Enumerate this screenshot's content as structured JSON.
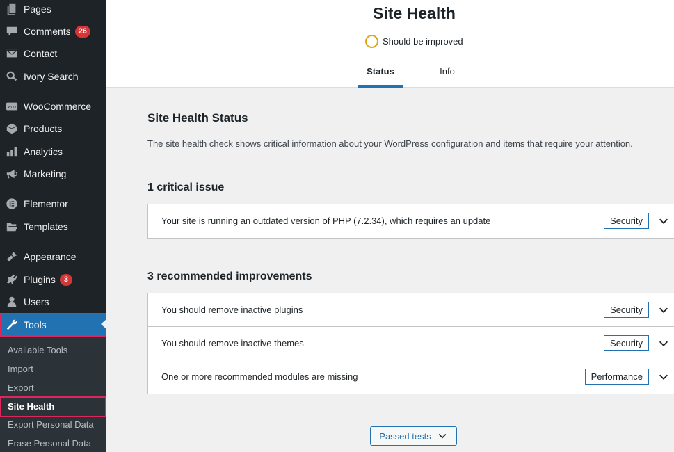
{
  "sidebar": {
    "items": [
      {
        "label": "Pages",
        "icon": "pages-icon"
      },
      {
        "label": "Comments",
        "icon": "comments-icon",
        "badge": "26"
      },
      {
        "label": "Contact",
        "icon": "envelope-icon"
      },
      {
        "label": "Ivory Search",
        "icon": "search-icon"
      },
      {
        "label": "WooCommerce",
        "icon": "woocommerce-icon"
      },
      {
        "label": "Products",
        "icon": "box-icon"
      },
      {
        "label": "Analytics",
        "icon": "bar-chart-icon"
      },
      {
        "label": "Marketing",
        "icon": "megaphone-icon"
      },
      {
        "label": "Elementor",
        "icon": "elementor-icon"
      },
      {
        "label": "Templates",
        "icon": "folder-icon"
      },
      {
        "label": "Appearance",
        "icon": "paintbrush-icon"
      },
      {
        "label": "Plugins",
        "icon": "plugin-icon",
        "badge": "3"
      },
      {
        "label": "Users",
        "icon": "user-icon"
      },
      {
        "label": "Tools",
        "icon": "wrench-icon",
        "active": true
      }
    ],
    "submenu": [
      {
        "label": "Available Tools"
      },
      {
        "label": "Import"
      },
      {
        "label": "Export"
      },
      {
        "label": "Site Health",
        "current": true
      },
      {
        "label": "Export Personal Data"
      },
      {
        "label": "Erase Personal Data"
      }
    ]
  },
  "header": {
    "title": "Site Health",
    "status": "Should be improved",
    "status_color": "#dba617",
    "tabs": [
      {
        "label": "Status",
        "active": true
      },
      {
        "label": "Info"
      }
    ]
  },
  "main": {
    "heading": "Site Health Status",
    "description": "The site health check shows critical information about your WordPress configuration and items that require your attention.",
    "critical": {
      "heading": "1 critical issue",
      "items": [
        {
          "title": "Your site is running an outdated version of PHP (7.2.34), which requires an update",
          "badge": "Security"
        }
      ]
    },
    "recommended": {
      "heading": "3 recommended improvements",
      "items": [
        {
          "title": "You should remove inactive plugins",
          "badge": "Security"
        },
        {
          "title": "You should remove inactive themes",
          "badge": "Security"
        },
        {
          "title": "One or more recommended modules are missing",
          "badge": "Performance"
        }
      ]
    },
    "passed_button": "Passed tests"
  },
  "colors": {
    "accent": "#2271b1",
    "sidebar_bg": "#1d2327",
    "badge_red": "#d63638",
    "highlight_outline": "#e0245e"
  }
}
